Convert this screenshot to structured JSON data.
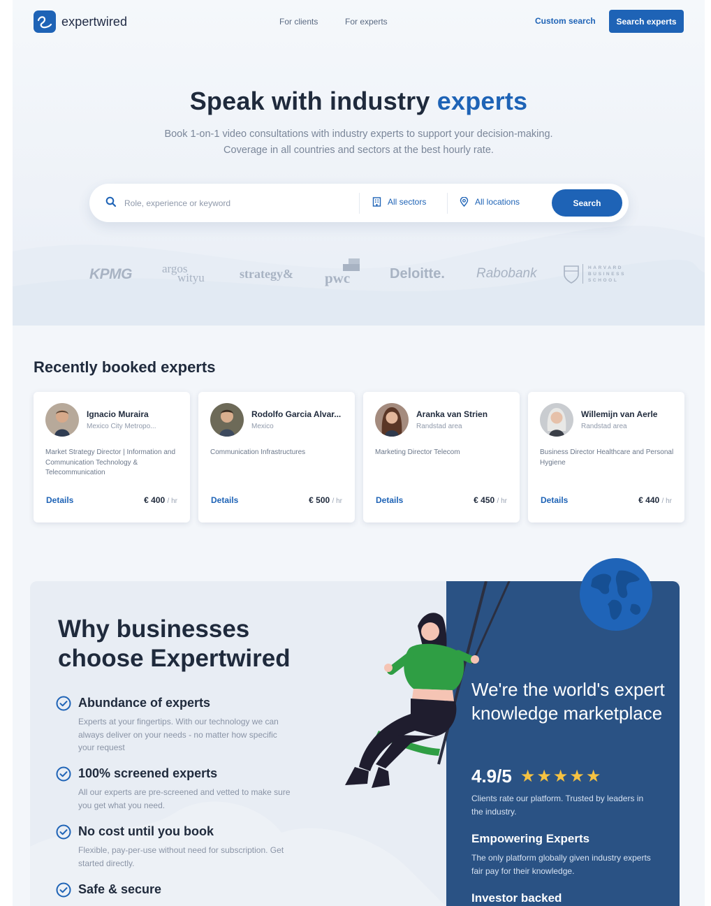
{
  "nav": {
    "logo_text": "expertwired",
    "links": [
      "For clients",
      "For experts"
    ],
    "custom_search": "Custom search",
    "cta": "Search experts"
  },
  "hero": {
    "title_main": "Speak with industry",
    "title_accent": "experts",
    "subtitle_1": "Book 1-on-1 video consultations with industry experts to support your decision-making.",
    "subtitle_2": "Coverage in all countries and sectors at the best hourly rate."
  },
  "search": {
    "placeholder": "Role, experience or keyword",
    "sectors": "All sectors",
    "locations": "All locations",
    "button": "Search"
  },
  "logos": {
    "kpmg": "KPMG",
    "argos_1": "argos",
    "argos_2": "wityu",
    "strategy": "strategy&",
    "pwc": "pwc",
    "deloitte": "Deloitte.",
    "rabobank": "Rabobank",
    "hbs_1": "HARVARD",
    "hbs_2": "BUSINESS",
    "hbs_3": "SCHOOL"
  },
  "recent": {
    "title": "Recently booked experts",
    "details_label": "Details",
    "unit": "/ hr",
    "experts": [
      {
        "name": "Ignacio Muraira",
        "location": "Mexico City Metropo...",
        "role": "Market Strategy Director | Information and Communication Technology & Telecommunication",
        "price": "€ 400"
      },
      {
        "name": "Rodolfo Garcia Alvar...",
        "location": "Mexico",
        "role": "Communication Infrastructures",
        "price": "€ 500"
      },
      {
        "name": "Aranka van Strien",
        "location": "Randstad area",
        "role": "Marketing Director Telecom",
        "price": "€ 450"
      },
      {
        "name": "Willemijn van Aerle",
        "location": "Randstad area",
        "role": "Business Director Healthcare and Personal Hygiene",
        "price": "€ 440"
      }
    ]
  },
  "why": {
    "title_1": "Why businesses",
    "title_2": "choose Expertwired",
    "features": [
      {
        "title": "Abundance of experts",
        "desc": "Experts at your fingertips. With our technology we can always deliver on your needs - no matter how specific your request"
      },
      {
        "title": "100% screened experts",
        "desc": "All our experts are pre-screened and vetted to make sure you get what you need."
      },
      {
        "title": "No cost until you book",
        "desc": "Flexible, pay-per-use without need for subscription. Get started directly."
      },
      {
        "title": "Safe & secure",
        "desc": ""
      }
    ]
  },
  "panel": {
    "title": "We're the world's expert knowledge marketplace",
    "rating": "4.9/5",
    "stars": "★★★★★",
    "rating_text": "Clients rate our platform. Trusted by leaders in the industry.",
    "h1": "Empowering Experts",
    "h1_text": "The only platform globally given industry experts fair pay for their knowledge.",
    "h2": "Investor backed"
  },
  "colors": {
    "brand_blue": "#1e63b6",
    "panel_blue": "#2a5284",
    "star": "#f5c242"
  }
}
